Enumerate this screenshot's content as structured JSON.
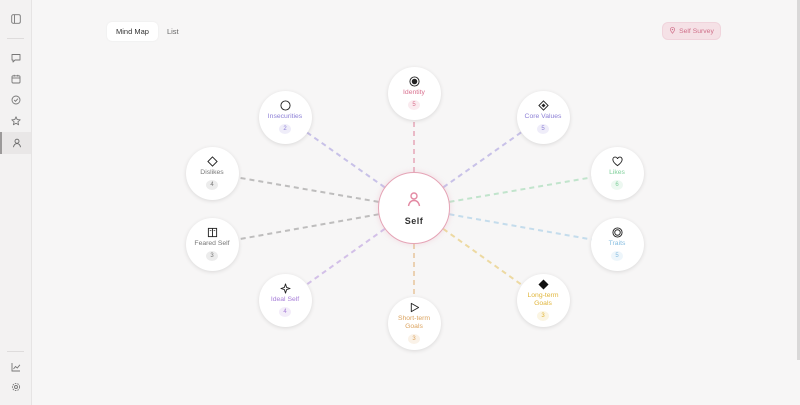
{
  "tabs": [
    {
      "label": "Mind Map",
      "active": true
    },
    {
      "label": "List",
      "active": false
    }
  ],
  "survey_button": {
    "label": "Self Survey",
    "icon": "pin-icon"
  },
  "sidebar": {
    "top_icons": [
      "sidebar-toggle-icon",
      "chat-icon",
      "calendar-icon",
      "check-circle-icon",
      "star-icon",
      "person-icon"
    ],
    "bottom_icons": [
      "chart-icon",
      "gear-icon"
    ],
    "active": "person-icon"
  },
  "center": {
    "label": "Self",
    "icon": "person-icon",
    "color": "#e38aa3"
  },
  "nodes": [
    {
      "key": "identity",
      "label": "Identity",
      "count": "5",
      "icon": "target-icon",
      "color": "#d9718f"
    },
    {
      "key": "core-values",
      "label": "Core Values",
      "count": "5",
      "icon": "diamond-dot-icon",
      "color": "#8d80d6"
    },
    {
      "key": "likes",
      "label": "Likes",
      "count": "6",
      "icon": "heart-icon",
      "color": "#7fcf9a"
    },
    {
      "key": "traits",
      "label": "Traits",
      "count": "5",
      "icon": "ring-icon",
      "color": "#86bde0"
    },
    {
      "key": "long-term-goals",
      "label": "Long-term Goals",
      "count": "3",
      "icon": "diamond-filled-icon",
      "color": "#e0b53a"
    },
    {
      "key": "short-term-goals",
      "label": "Short-term Goals",
      "count": "3",
      "icon": "play-icon",
      "color": "#dba35f"
    },
    {
      "key": "ideal-self",
      "label": "Ideal Self",
      "count": "4",
      "icon": "sparkle-icon",
      "color": "#a77ed8"
    },
    {
      "key": "feared-self",
      "label": "Feared Self",
      "count": "3",
      "icon": "book-icon",
      "color": "#777777"
    },
    {
      "key": "dislikes",
      "label": "Dislikes",
      "count": "4",
      "icon": "diamond-outline-icon",
      "color": "#777777"
    },
    {
      "key": "insecurities",
      "label": "Insecurities",
      "count": "2",
      "icon": "circle-icon",
      "color": "#8d80d6"
    }
  ]
}
